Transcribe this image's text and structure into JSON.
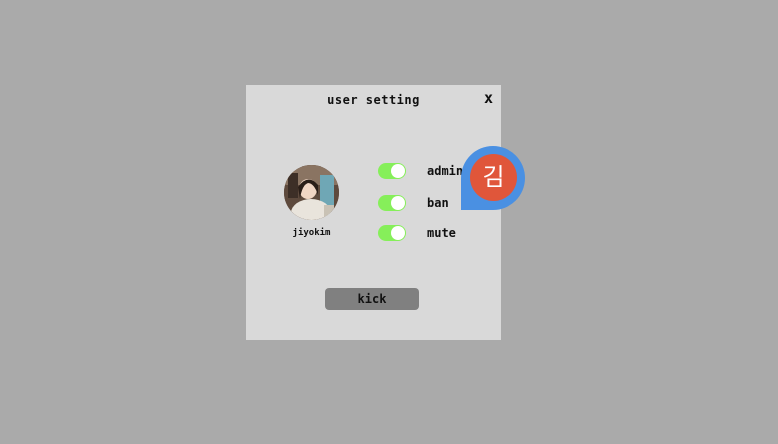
{
  "dialog": {
    "title": "user setting",
    "close_label": "x",
    "user": {
      "username": "jiyokim"
    },
    "toggles": [
      {
        "label": "admin",
        "on": true
      },
      {
        "label": "ban",
        "on": true
      },
      {
        "label": "mute",
        "on": true
      }
    ],
    "kick_label": "kick"
  },
  "floating_badge": {
    "text": "김"
  },
  "colors": {
    "backdrop": "#aaaaaa",
    "dialog_bg": "#d9d9d9",
    "toggle_on": "#86ef5a",
    "kick_button": "#808080",
    "badge_ring": "#4a90e2",
    "badge_fill": "#e0563a"
  }
}
